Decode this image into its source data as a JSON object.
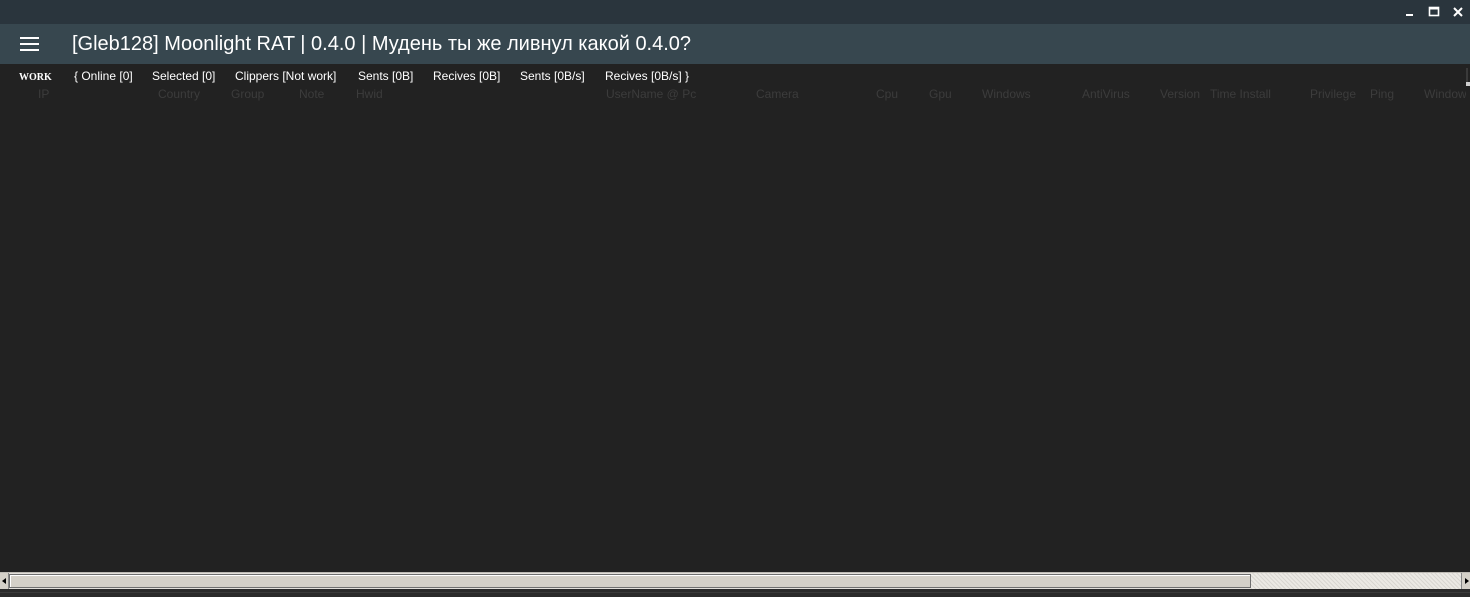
{
  "window": {
    "controls": {
      "minimize_icon": "minimize-icon",
      "maximize_icon": "maximize-icon",
      "close_icon": "close-icon"
    }
  },
  "header": {
    "menu_icon": "hamburger-menu-icon",
    "title": "[Gleb128] Moonlight RAT | 0.4.0 | Мудень ты же ливнул какой 0.4.0?"
  },
  "status": {
    "work_label": "WORK",
    "online": "{ Online [0]",
    "selected": "Selected [0]",
    "clippers": "Clippers [Not work]",
    "sents_total": "Sents [0B]",
    "recives_total": "Recives [0B]",
    "sents_rate": "Sents [0B/s]",
    "recives_rate": "Recives [0B/s] }"
  },
  "table": {
    "columns": [
      "IP",
      "Country",
      "Group",
      "Note",
      "Hwid",
      "UserName @ Pc",
      "Camera",
      "Cpu",
      "Gpu",
      "Windows",
      "AntiVirus",
      "Version",
      "Time Install",
      "Privilege",
      "Ping",
      "Windows"
    ],
    "rows": []
  },
  "colors": {
    "titlebar": "#2a353d",
    "header": "#37474f",
    "background": "#222222",
    "column_header_text": "#3c3c3c",
    "text": "#ffffff"
  }
}
